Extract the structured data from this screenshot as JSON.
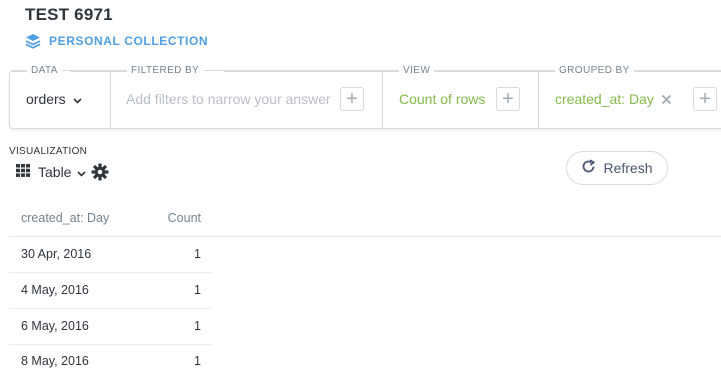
{
  "header": {
    "title": "TEST 6971",
    "collection": "PERSONAL COLLECTION"
  },
  "query_builder": {
    "data": {
      "label": "DATA",
      "value": "orders"
    },
    "filtered_by": {
      "label": "FILTERED BY",
      "placeholder": "Add filters to narrow your answer"
    },
    "view": {
      "label": "VIEW",
      "value": "Count of rows"
    },
    "grouped_by": {
      "label": "GROUPED BY",
      "value": "created_at: Day"
    }
  },
  "visualization": {
    "label": "VISUALIZATION",
    "type": "Table",
    "refresh_label": "Refresh"
  },
  "table": {
    "columns": [
      "created_at: Day",
      "Count"
    ],
    "rows": [
      [
        "30 Apr, 2016",
        "1"
      ],
      [
        "4 May, 2016",
        "1"
      ],
      [
        "6 May, 2016",
        "1"
      ],
      [
        "8 May, 2016",
        "1"
      ]
    ]
  },
  "colors": {
    "brand": "#509ee3",
    "accent_green": "#84bb4c",
    "text_dark": "#2e353b",
    "text_muted": "#74838f",
    "border": "#d7dbde"
  }
}
